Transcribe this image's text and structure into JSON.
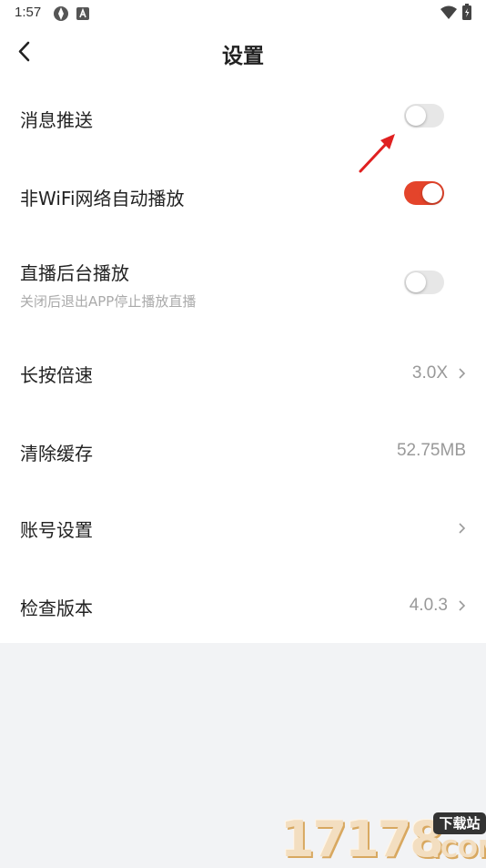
{
  "status_bar": {
    "time": "1:57"
  },
  "header": {
    "title": "设置"
  },
  "settings": {
    "push": {
      "label": "消息推送",
      "toggle_on": false
    },
    "non_wifi_autoplay": {
      "label": "非WiFi网络自动播放",
      "toggle_on": true
    },
    "live_background": {
      "label": "直播后台播放",
      "sublabel": "关闭后退出APP停止播放直播",
      "toggle_on": false
    },
    "long_press_speed": {
      "label": "长按倍速",
      "value": "3.0X"
    },
    "clear_cache": {
      "label": "清除缓存",
      "value": "52.75MB"
    },
    "account": {
      "label": "账号设置"
    },
    "check_version": {
      "label": "检查版本",
      "value": "4.0.3"
    }
  },
  "colors": {
    "accent": "#e4442b",
    "toggle_off": "#e7e7e7",
    "annotation_arrow": "#e02020"
  },
  "watermark": {
    "number": "17178",
    "badge": "下载站",
    "domain": ".COM"
  }
}
